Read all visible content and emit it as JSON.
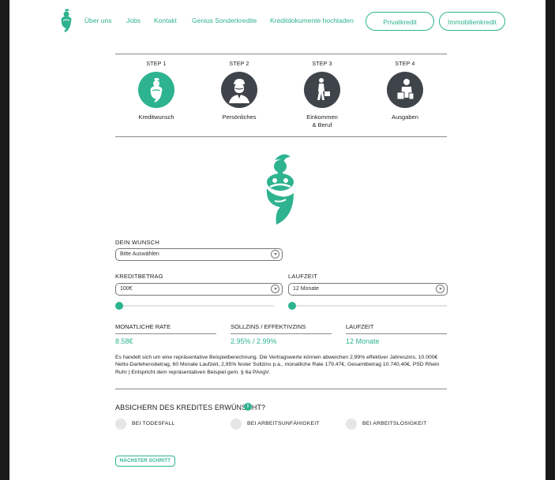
{
  "nav": {
    "links": [
      "Über uns",
      "Jobs",
      "Kontakt",
      "Genius Sonderkredite",
      "Kreditdokumente hochladen"
    ],
    "buttons": [
      "Privatkredit",
      "Immobilienkredit"
    ]
  },
  "steps": [
    {
      "label": "STEP 1",
      "name": "Kreditwunsch",
      "icon": "genie-icon",
      "active": true
    },
    {
      "label": "STEP 2",
      "name": "Persönliches",
      "icon": "person-icon",
      "active": false
    },
    {
      "label": "STEP 3",
      "name_line1": "Einkommen",
      "name_line2": "& Beruf",
      "icon": "walking-briefcase-icon",
      "active": false
    },
    {
      "label": "STEP 4",
      "name": "Ausgaben",
      "icon": "shopping-icon",
      "active": false
    }
  ],
  "form": {
    "wunsch_label": "DEIN WUNSCH",
    "wunsch_value": "Bitte Auswählen",
    "kreditbetrag_label": "KREDITBETRAG",
    "kreditbetrag_value": "100€",
    "laufzeit_label": "LAUFZEIT",
    "laufzeit_value": "12 Monate"
  },
  "sliders": {
    "kreditbetrag_level": 0.0,
    "laufzeit_level": 0.0
  },
  "stats": [
    {
      "head": "MONATLICHE RATE",
      "value": "8.58€"
    },
    {
      "head": "SOLLZINS / EFFEKTIVZINS",
      "value": "2.95% / 2.99%"
    },
    {
      "head": "LAUFZEIT",
      "value": "12 Monate"
    }
  ],
  "disclaimer": "Es handelt sich um eine repräsentative Beispielberechnung. Die Vertragswerte können abweichen 2,99% effektiver Jahreszins, 10.000€ Netto-Darlehensbetrag, 60 Monate Laufzeit, 2,95% fester Sollzins p.a., monatliche Rate 179,47€, Gesamtbetrag 10.740,40€, PSD Rhein Ruhr | Entspricht dem repräsentativen Beispiel gem. § 6a PAngV.",
  "insurance": {
    "title": "ABSICHERN DES KREDITES ERWÜNSCHT?",
    "info": "i",
    "options": [
      "BEI TODESFALL",
      "BEI ARBEITSUNFÄHIGKEIT",
      "BEI ARBEITSLOSIGKEIT"
    ]
  },
  "next_button": "NÄCHSTER SCHRITT",
  "colors": {
    "accent": "#2db38f",
    "dark_icon": "#3f444b"
  }
}
